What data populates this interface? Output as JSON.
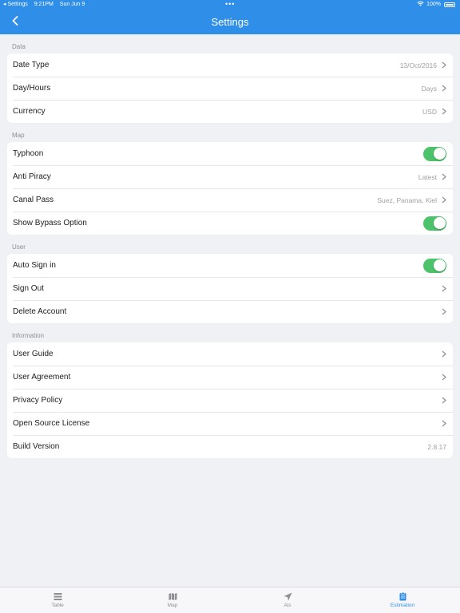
{
  "status_bar": {
    "back_app": "◂ Settings",
    "time": "9:21PM",
    "date": "Sun Jun 9",
    "dots": "•••",
    "battery": "100%"
  },
  "nav": {
    "title": "Settings"
  },
  "sections": {
    "data": {
      "header": "Data",
      "date_type": {
        "label": "Date Type",
        "value": "13/Oct/2016"
      },
      "day_hours": {
        "label": "Day/Hours",
        "value": "Days"
      },
      "currency": {
        "label": "Currency",
        "value": "USD"
      }
    },
    "map": {
      "header": "Map",
      "typhoon": {
        "label": "Typhoon",
        "on": true
      },
      "anti_piracy": {
        "label": "Anti Piracy",
        "value": "Latest"
      },
      "canal_pass": {
        "label": "Canal Pass",
        "value": "Suez, Panama, Kiel"
      },
      "bypass": {
        "label": "Show Bypass Option",
        "on": true
      }
    },
    "user": {
      "header": "User",
      "auto_sign_in": {
        "label": "Auto Sign in",
        "on": true
      },
      "sign_out": {
        "label": "Sign Out"
      },
      "delete_account": {
        "label": "Delete Account"
      }
    },
    "information": {
      "header": "Information",
      "user_guide": {
        "label": "User Guide"
      },
      "user_agreement": {
        "label": "User Agreement"
      },
      "privacy_policy": {
        "label": "Privacy Policy"
      },
      "open_source": {
        "label": "Open Source License"
      },
      "build_version": {
        "label": "Build Version",
        "value": "2.8.17"
      }
    }
  },
  "tabs": [
    {
      "label": "Table",
      "icon": "list-icon"
    },
    {
      "label": "Map",
      "icon": "map-icon"
    },
    {
      "label": "Ais",
      "icon": "navigation-arrow-icon"
    },
    {
      "label": "Estimation",
      "icon": "clipboard-icon",
      "active": true
    }
  ],
  "colors": {
    "accent": "#2f8fe8",
    "toggle_on": "#4cc36a",
    "background": "#f0f1f5"
  }
}
